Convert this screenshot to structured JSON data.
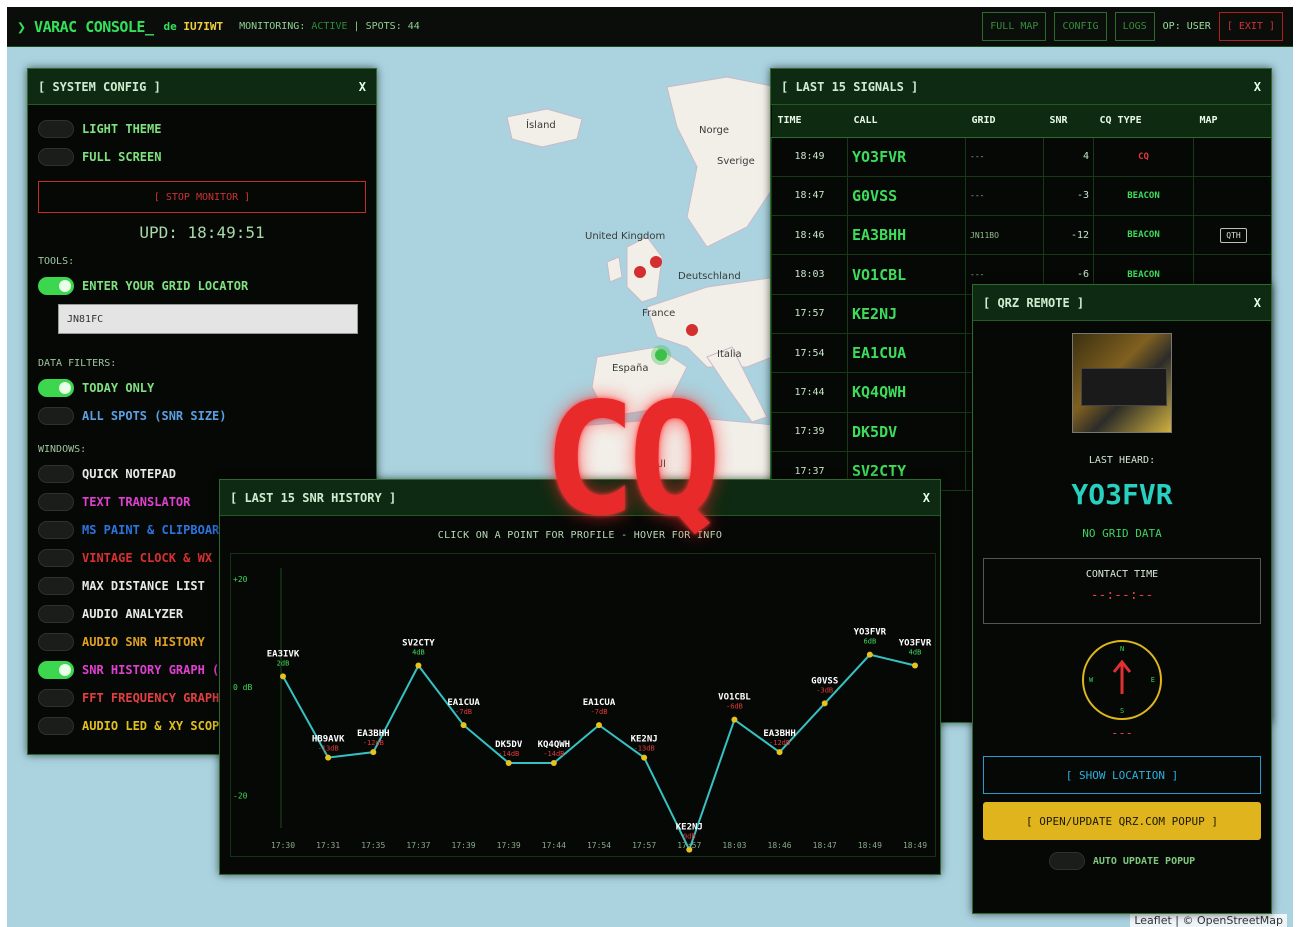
{
  "topbar": {
    "brand": "❯ VARAC CONSOLE_",
    "de_prefix": "de",
    "callsign": "IU7IWT",
    "monitoring_label": "MONITORING:",
    "monitoring_status": "ACTIVE",
    "spots_label": "| SPOTS: 44",
    "buttons": {
      "full_map": "FULL MAP",
      "config": "CONFIG",
      "logs": "LOGS"
    },
    "op": "OP: USER",
    "exit": "[ EXIT ]"
  },
  "map": {
    "labels": {
      "island": "Ísland",
      "norge": "Norge",
      "sverige": "Sverige",
      "uk": "United Kingdom",
      "deutschland": "Deutschland",
      "france": "France",
      "italia": "Italia",
      "espana": "España",
      "alger": "الجزائر"
    },
    "attribution": "Leaflet | © OpenStreetMap"
  },
  "sysconfig": {
    "title": "[ SYSTEM CONFIG ]",
    "close": "X",
    "light_theme": "LIGHT THEME",
    "full_screen": "FULL SCREEN",
    "stop_monitor": "[ STOP MONITOR ]",
    "upd": "UPD: 18:49:51",
    "tools_label": "TOOLS:",
    "enter_grid": "ENTER YOUR GRID LOCATOR",
    "grid_value": "JN81FC",
    "data_filters": "DATA FILTERS:",
    "today_only": "TODAY ONLY",
    "all_spots": "ALL SPOTS (SNR SIZE)",
    "windows_label": "WINDOWS:",
    "windows": [
      {
        "label": "QUICK NOTEPAD",
        "color": "#e8e8e8",
        "on": false
      },
      {
        "label": "TEXT TRANSLATOR",
        "color": "#e040d0",
        "on": false
      },
      {
        "label": "MS PAINT & CLIPBOARD",
        "color": "#2c74e0",
        "on": false
      },
      {
        "label": "VINTAGE CLOCK & WX",
        "color": "#d83030",
        "on": false
      },
      {
        "label": "MAX DISTANCE LIST",
        "color": "#e8e8e8",
        "on": false
      },
      {
        "label": "AUDIO ANALYZER",
        "color": "#e8e8e8",
        "on": false
      },
      {
        "label": "AUDIO SNR HISTORY",
        "color": "#e0a020",
        "on": false
      },
      {
        "label": "SNR HISTORY GRAPH (",
        "color": "#e040d0",
        "on": true
      },
      {
        "label": "FFT FREQUENCY GRAPH",
        "color": "#e04040",
        "on": false
      },
      {
        "label": "AUDIO LED & XY SCOPE",
        "color": "#e0c020",
        "on": false
      }
    ]
  },
  "signals": {
    "title": "[ LAST 15 SIGNALS ]",
    "close": "X",
    "headers": [
      "TIME",
      "CALL",
      "GRID",
      "SNR",
      "CQ TYPE",
      "MAP"
    ],
    "rows": [
      {
        "time": "18:49",
        "call": "YO3FVR",
        "grid": "---",
        "snr": "4",
        "type": "CQ",
        "type_color": "#e03a3a",
        "map": ""
      },
      {
        "time": "18:47",
        "call": "G0VSS",
        "grid": "---",
        "snr": "-3",
        "type": "BEACON",
        "type_color": "#3ddc5a",
        "map": ""
      },
      {
        "time": "18:46",
        "call": "EA3BHH",
        "grid": "JN11BO",
        "snr": "-12",
        "type": "BEACON",
        "type_color": "#3ddc5a",
        "map": "QTH"
      },
      {
        "time": "18:03",
        "call": "VO1CBL",
        "grid": "---",
        "snr": "-6",
        "type": "BEACON",
        "type_color": "#3ddc5a",
        "map": ""
      },
      {
        "time": "17:57",
        "call": "KE2NJ",
        "grid": "",
        "snr": "",
        "type": "",
        "type_color": "#3ddc5a",
        "map": ""
      },
      {
        "time": "17:54",
        "call": "EA1CUA",
        "grid": "",
        "snr": "",
        "type": "",
        "type_color": "#3ddc5a",
        "map": ""
      },
      {
        "time": "17:44",
        "call": "KQ4QWH",
        "grid": "",
        "snr": "",
        "type": "",
        "type_color": "#3ddc5a",
        "map": ""
      },
      {
        "time": "17:39",
        "call": "DK5DV",
        "grid": "",
        "snr": "",
        "type": "",
        "type_color": "#3ddc5a",
        "map": ""
      },
      {
        "time": "17:37",
        "call": "SV2CTY",
        "grid": "",
        "snr": "",
        "type": "",
        "type_color": "#3ddc5a",
        "map": ""
      }
    ]
  },
  "qrz": {
    "title": "[ QRZ REMOTE ]",
    "close": "X",
    "last_heard_label": "LAST HEARD:",
    "last_heard_call": "YO3FVR",
    "no_grid": "NO GRID DATA",
    "contact_time_label": "CONTACT TIME",
    "contact_time_value": "--:--:--",
    "compass": {
      "n": "N",
      "e": "E",
      "s": "S",
      "w": "W"
    },
    "bearing_value": "---",
    "show_location": "[ SHOW LOCATION ]",
    "open_popup": "[ OPEN/UPDATE QRZ.COM POPUP ]",
    "auto_update": "AUTO UPDATE POPUP"
  },
  "snr_history": {
    "title": "[ LAST 15 SNR HISTORY ]",
    "close": "X",
    "hint": "CLICK ON A POINT FOR PROFILE - HOVER FOR INFO",
    "y_tick_labels": [
      "+20",
      "0 dB",
      "-20"
    ]
  },
  "chart_data": {
    "type": "line",
    "x": [
      "17:30",
      "17:31",
      "17:35",
      "17:37",
      "17:39",
      "17:39",
      "17:44",
      "17:54",
      "17:57",
      "17:57",
      "18:03",
      "18:46",
      "18:47",
      "18:49",
      "18:49"
    ],
    "point_labels": [
      "EA3IVK",
      "HB9AVK",
      "EA3BHH",
      "SV2CTY",
      "EA1CUA",
      "DK5DV",
      "KQ4QWH",
      "EA1CUA",
      "KE2NJ",
      "KE2NJ",
      "VO1CBL",
      "EA3BHH",
      "G0VSS",
      "YO3FVR",
      "YO3FVR"
    ],
    "value_labels": [
      "2dB",
      "-13dB",
      "-12dB",
      "4dB",
      "-7dB",
      "-14dB",
      "-14dB",
      "-7dB",
      "-13dB",
      "0dB",
      "-6dB",
      "-12dB",
      "-3dB",
      "6dB",
      "4dB"
    ],
    "series": [
      {
        "values": [
          2,
          -13,
          -12,
          4,
          -7,
          -14,
          -14,
          -7,
          -13,
          -30,
          -6,
          -12,
          -3,
          6,
          4
        ]
      }
    ],
    "ylim": [
      -26,
      22
    ],
    "yticks": [
      20,
      0,
      -20
    ],
    "line_color": "#36c2c2",
    "point_color": "#e8c21c",
    "label_color": "#ffffff",
    "value_color_pos": "#3ddc5a",
    "value_color_neg": "#e03a3a",
    "grid": false
  },
  "overlay": {
    "cq": "CQ"
  }
}
